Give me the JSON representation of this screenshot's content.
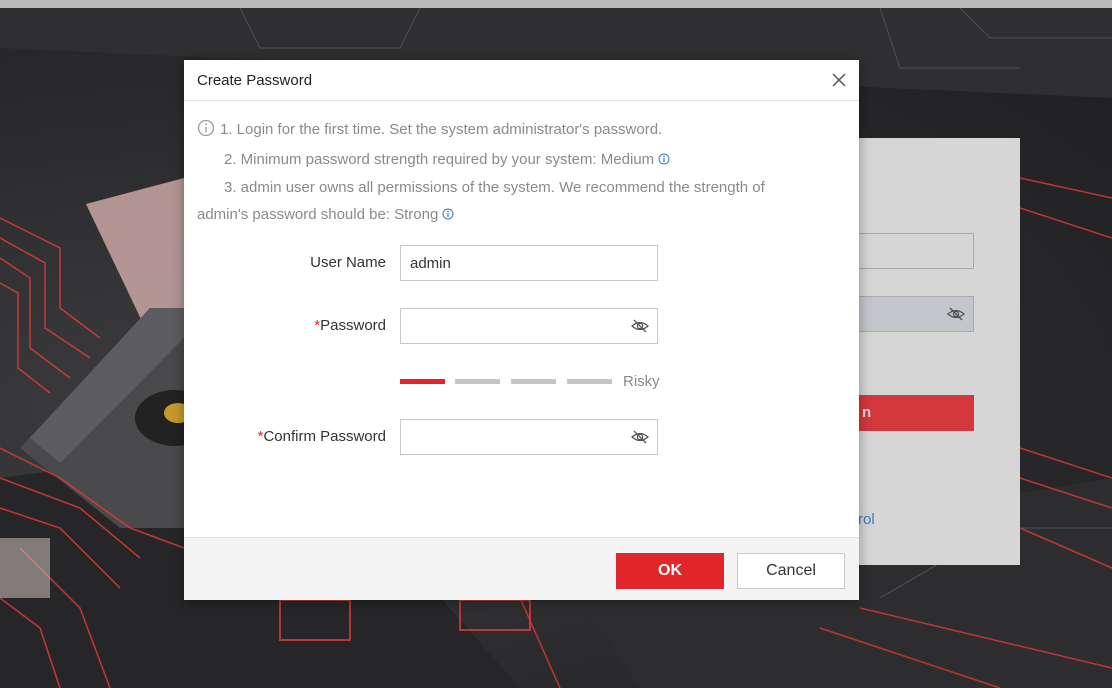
{
  "background": {
    "login_button_label_fragment": "n",
    "login_link_fragment": "rol"
  },
  "dialog": {
    "title": "Create Password",
    "close_icon": "close-icon",
    "notes": {
      "line1": "1. Login for the first time. Set the system administrator's password.",
      "line2": "2. Minimum password strength required by your system: Medium",
      "line3a": "3. admin user owns all permissions of the system. We recommend the strength of",
      "line3b": "admin's password should be: Strong"
    },
    "fields": {
      "username_label": "User Name",
      "username_value": "admin",
      "password_label": "Password",
      "password_value": "",
      "confirm_label": "Confirm Password",
      "confirm_value": "",
      "required_mark": "*"
    },
    "strength": {
      "label": "Risky",
      "level": 1,
      "levels_total": 4
    },
    "buttons": {
      "ok": "OK",
      "cancel": "Cancel"
    }
  },
  "colors": {
    "accent": "#e0252b",
    "info_blue": "#3a7bc8",
    "muted_text": "#8a8a8a"
  }
}
